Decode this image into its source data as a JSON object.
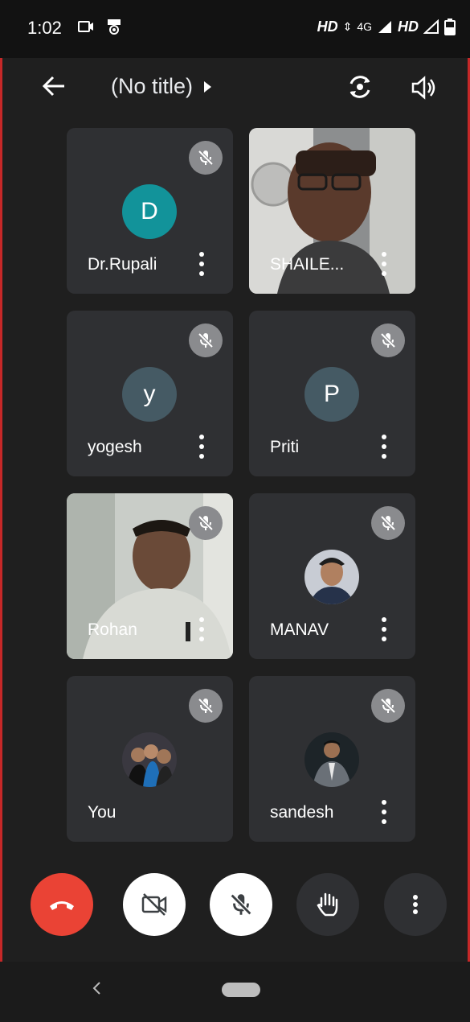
{
  "status_bar": {
    "time": "1:02",
    "network_hd1": "HD",
    "network_4g": "4G",
    "network_hd2": "HD"
  },
  "topbar": {
    "title": "(No title)"
  },
  "participants": [
    {
      "name": "Dr.Rupali",
      "initial": "D",
      "avatar_color": "#12939a",
      "kind": "initial",
      "muted": true
    },
    {
      "name": "SHAILE...",
      "kind": "video",
      "muted": false
    },
    {
      "name": "yogesh",
      "initial": "y",
      "avatar_color": "#455a64",
      "kind": "initial",
      "muted": true
    },
    {
      "name": "Priti",
      "initial": "P",
      "avatar_color": "#455a64",
      "kind": "initial",
      "muted": true
    },
    {
      "name": "Rohan",
      "kind": "video",
      "muted": true
    },
    {
      "name": "MANAV",
      "kind": "photo",
      "muted": true
    },
    {
      "name": "You",
      "kind": "photo",
      "muted": true
    },
    {
      "name": "sandesh",
      "kind": "photo",
      "muted": true
    }
  ],
  "controls": {
    "end_call_color": "#ea4335",
    "items": [
      "end-call",
      "camera-off",
      "mic-off",
      "raise-hand",
      "more-options"
    ]
  },
  "colors": {
    "background": "#1f1f1f",
    "tile": "#2f3033",
    "mute_badge": "#8a8b8e"
  }
}
